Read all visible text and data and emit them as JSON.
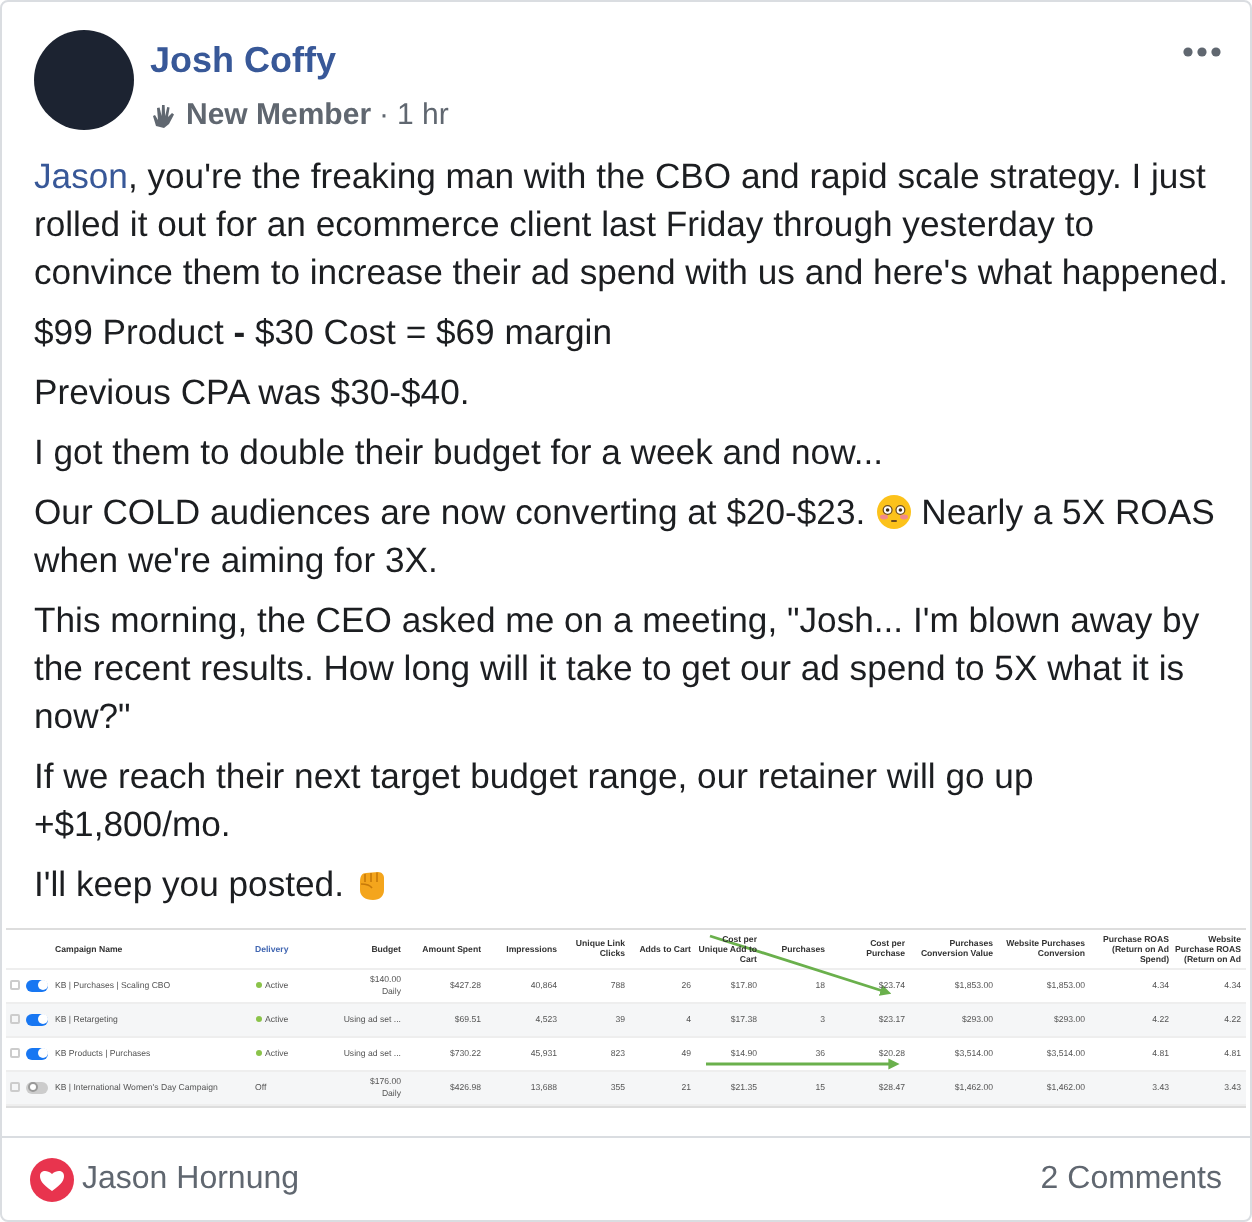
{
  "post": {
    "author": "Josh Coffy",
    "badge": "New Member",
    "separator": "·",
    "time": "1 hr"
  },
  "paragraphs": [
    {
      "parts": [
        {
          "kind": "mention",
          "text": "Jason"
        },
        {
          "kind": "text",
          "text": ", you're the freaking man with the CBO and rapid scale strategy. I just rolled it out for an ecommerce client last Friday through yesterday to convince them to increase their ad spend with us and here's what happened."
        }
      ]
    },
    {
      "parts": [
        {
          "kind": "text",
          "text": "$99 Product **-** $30 Cost = $69 margin"
        }
      ]
    },
    {
      "parts": [
        {
          "kind": "text",
          "text": "Previous CPA was $30-$40."
        }
      ]
    },
    {
      "parts": [
        {
          "kind": "text",
          "text": "I got them to double their budget for a week and now..."
        }
      ]
    },
    {
      "parts": [
        {
          "kind": "text",
          "text": "Our COLD audiences are now converting at $20-$23."
        },
        {
          "kind": "flushed-emoji"
        },
        {
          "kind": "text",
          "text": "Nearly a 5X ROAS when we're aiming for 3X."
        }
      ]
    },
    {
      "parts": [
        {
          "kind": "text",
          "text": "This morning, the CEO asked me on a meeting, \"Josh... I'm blown away by the recent results. How long will it take to get our ad spend to 5X what it is now?\""
        }
      ]
    },
    {
      "parts": [
        {
          "kind": "text",
          "text": "If we reach their next target budget range, our retainer will go up +$1,800/mo."
        }
      ]
    },
    {
      "parts": [
        {
          "kind": "text",
          "text": "I'll keep you posted."
        },
        {
          "kind": "fist-emoji"
        }
      ]
    }
  ],
  "table": {
    "columns": [
      "Campaign Name",
      "Delivery",
      "Budget",
      "Amount Spent",
      "Impressions",
      "Unique Link Clicks",
      "Adds to Cart",
      "Cost per Unique Add to Cart",
      "Purchases",
      "Cost per Purchase",
      "Purchases Conversion Value",
      "Website Purchases Conversion",
      "Purchase ROAS (Return on Ad Spend)",
      "Website Purchase ROAS (Return on Ad"
    ],
    "rows": [
      {
        "checked": false,
        "on": true,
        "active": true,
        "budget_period": "Daily",
        "cells": [
          "KB | Purchases | Scaling CBO",
          "Active",
          "$140.00",
          "$427.28",
          "40,864",
          "788",
          "26",
          "$17.80",
          "18",
          "$23.74",
          "$1,853.00",
          "$1,853.00",
          "4.34",
          "4.34"
        ]
      },
      {
        "checked": false,
        "on": true,
        "active": true,
        "cells": [
          "KB | Retargeting",
          "Active",
          "Using ad set ...",
          "$69.51",
          "4,523",
          "39",
          "4",
          "$17.38",
          "3",
          "$23.17",
          "$293.00",
          "$293.00",
          "4.22",
          "4.22"
        ]
      },
      {
        "checked": false,
        "on": true,
        "active": true,
        "cells": [
          "KB Products | Purchases",
          "Active",
          "Using ad set ...",
          "$730.22",
          "45,931",
          "823",
          "49",
          "$14.90",
          "36",
          "$20.28",
          "$3,514.00",
          "$3,514.00",
          "4.81",
          "4.81"
        ]
      },
      {
        "checked": false,
        "on": false,
        "active": false,
        "budget_period": "Daily",
        "cells": [
          "KB | International Women's Day Campaign",
          "Off",
          "$176.00",
          "$426.98",
          "13,688",
          "355",
          "21",
          "$21.35",
          "15",
          "$28.47",
          "$1,462.00",
          "$1,462.00",
          "3.43",
          "3.43"
        ]
      }
    ]
  },
  "footer": {
    "reactor": "Jason Hornung",
    "comments": "2 Comments"
  }
}
